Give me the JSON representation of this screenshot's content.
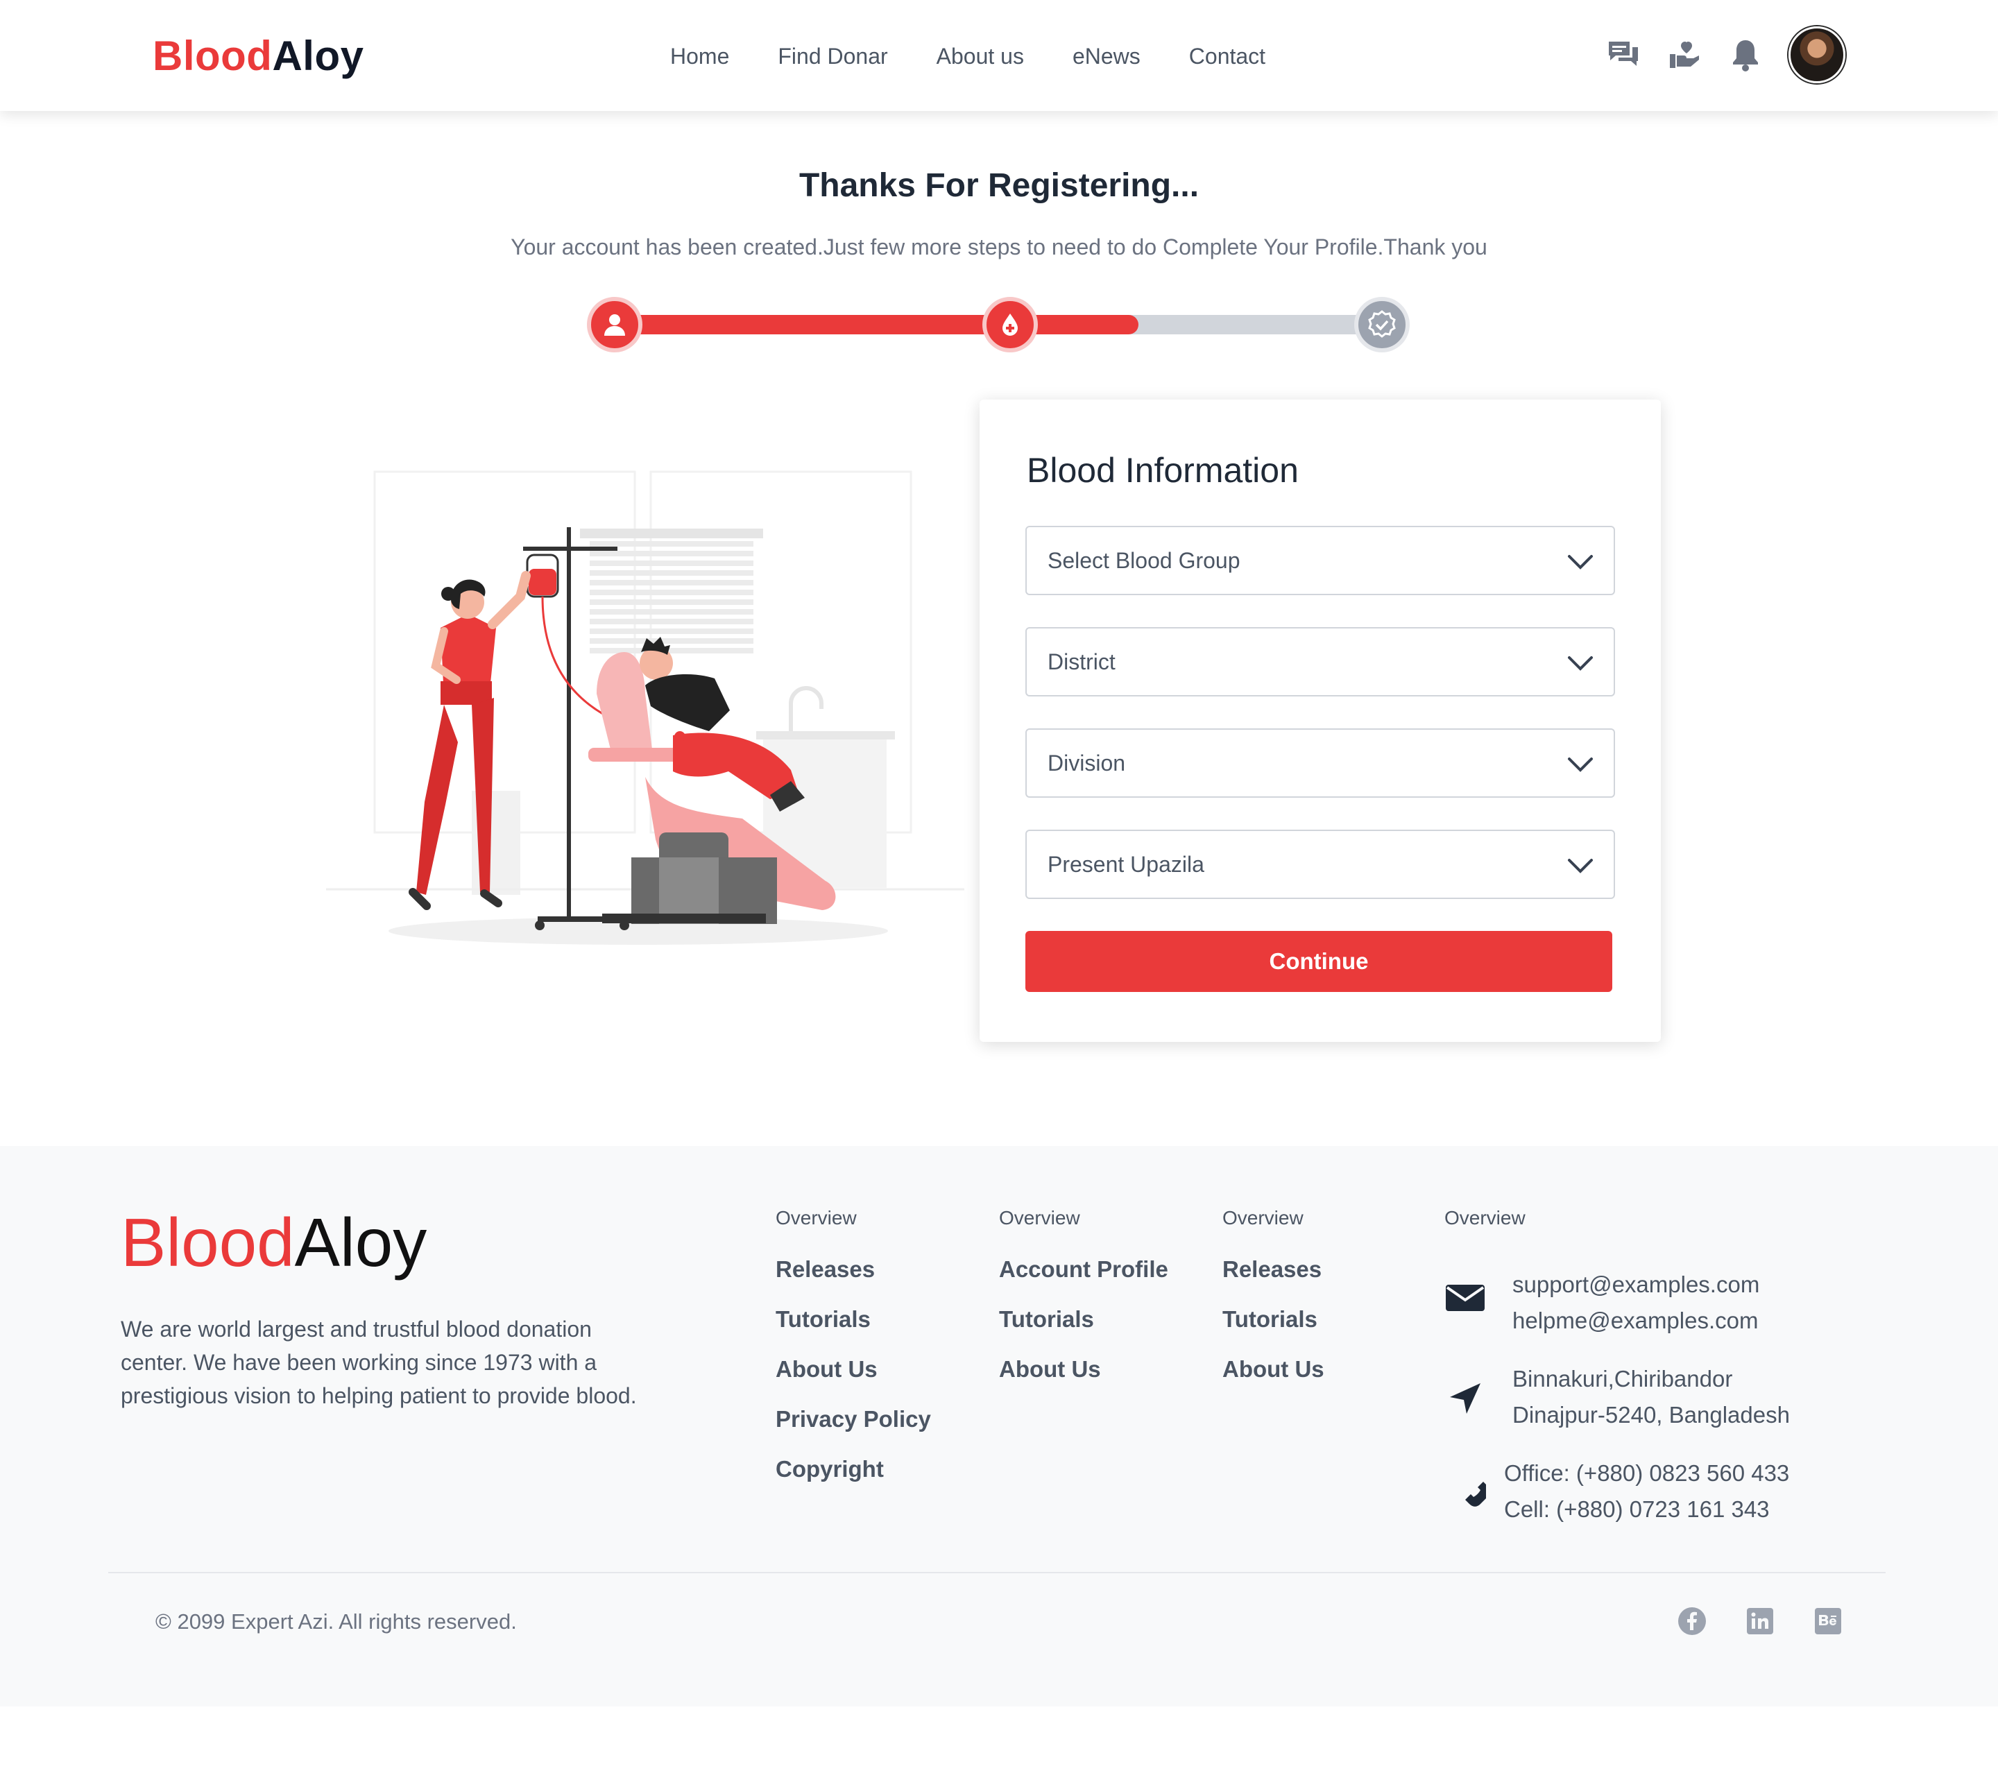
{
  "header": {
    "logo_part1": "Blood",
    "logo_part2": "Aloy",
    "nav": [
      "Home",
      "Find Donar",
      "About us",
      "eNews",
      "Contact"
    ],
    "icons": [
      "chat-icon",
      "donate-hand-icon",
      "bell-icon"
    ]
  },
  "hero": {
    "title": "Thanks For Registering...",
    "subtitle": "Your account has been created.Just few more steps to need to do Complete Your Profile.Thank you",
    "progress_fraction": 0.68,
    "steps": [
      "user-icon",
      "blood-drop-icon",
      "verified-badge-icon"
    ]
  },
  "form": {
    "title": "Blood Information",
    "fields": [
      "Select Blood Group",
      "District",
      "Division",
      "Present Upazila"
    ],
    "submit": "Continue"
  },
  "footer": {
    "logo_part1": "Blood",
    "logo_part2": "Aloy",
    "description": "We are world largest and trustful blood donation center. We have been working since 1973 with a prestigious vision to helping patient to provide blood.",
    "columns": [
      {
        "title": "Overview",
        "links": [
          "Releases",
          "Tutorials",
          "About Us",
          "Privacy Policy",
          "Copyright"
        ]
      },
      {
        "title": "Overview",
        "links": [
          "Account Profile",
          "Tutorials",
          "About Us"
        ]
      },
      {
        "title": "Overview",
        "links": [
          "Releases",
          "Tutorials",
          "About Us"
        ]
      }
    ],
    "contact_title": "Overview",
    "emails": [
      "support@examples.com",
      "helpme@examples.com"
    ],
    "address": [
      "Binnakuri,Chiribandor",
      "Dinajpur-5240, Bangladesh"
    ],
    "phones": [
      "Office: (+880) 0823 560 433",
      "Cell: (+880) 0723 161 343"
    ],
    "copyright": "© 2099 Expert Azi. All rights reserved.",
    "social": [
      "facebook-icon",
      "linkedin-icon",
      "behance-icon"
    ]
  },
  "colors": {
    "accent": "#ea3a3a",
    "text": "#1f2937",
    "muted": "#6b7280",
    "footer_bg": "#f8f9fa"
  }
}
